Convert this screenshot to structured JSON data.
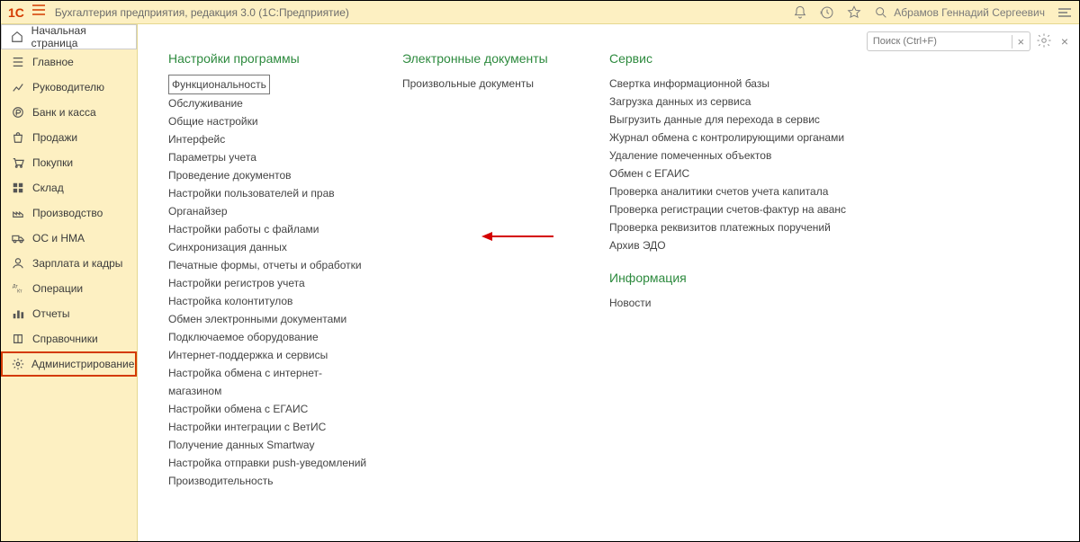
{
  "topbar": {
    "logo": "1C",
    "title": "Бухгалтерия предприятия, редакция 3.0  (1С:Предприятие)",
    "user": "Абрамов Геннадий Сергеевич"
  },
  "sidebar": {
    "home": "Начальная страница",
    "items": [
      {
        "icon": "list",
        "label": "Главное"
      },
      {
        "icon": "chart",
        "label": "Руководителю"
      },
      {
        "icon": "ruble",
        "label": "Банк и касса"
      },
      {
        "icon": "bag",
        "label": "Продажи"
      },
      {
        "icon": "cart",
        "label": "Покупки"
      },
      {
        "icon": "boxes",
        "label": "Склад"
      },
      {
        "icon": "factory",
        "label": "Производство"
      },
      {
        "icon": "truck",
        "label": "ОС и НМА"
      },
      {
        "icon": "person",
        "label": "Зарплата и кадры"
      },
      {
        "icon": "dkt",
        "label": "Операции"
      },
      {
        "icon": "bars",
        "label": "Отчеты"
      },
      {
        "icon": "book",
        "label": "Справочники"
      },
      {
        "icon": "gear",
        "label": "Администрирование"
      }
    ]
  },
  "columns": {
    "settings": {
      "title": "Настройки программы",
      "items": [
        "Функциональность",
        "Обслуживание",
        "Общие настройки",
        "Интерфейс",
        "Параметры учета",
        "Проведение документов",
        "Настройки пользователей и прав",
        "Органайзер",
        "Настройки работы с файлами",
        "Синхронизация данных",
        "Печатные формы, отчеты и обработки",
        "Настройки регистров учета",
        "Настройка колонтитулов",
        "Обмен электронными документами",
        "Подключаемое оборудование",
        "Интернет-поддержка и сервисы",
        "Настройка обмена с интернет-магазином",
        "Настройки обмена с ЕГАИС",
        "Настройки интеграции с ВетИС",
        "Получение данных Smartway",
        "Настройка отправки push-уведомлений",
        "Производительность"
      ]
    },
    "edocs": {
      "title": "Электронные документы",
      "items": [
        "Произвольные документы"
      ]
    },
    "service": {
      "title": "Сервис",
      "items": [
        "Свертка информационной базы",
        "Загрузка данных из сервиса",
        "Выгрузить данные для перехода в сервис",
        "Журнал обмена с контролирующими органами",
        "Удаление помеченных объектов",
        "Обмен с ЕГАИС",
        "Проверка аналитики счетов учета капитала",
        "Проверка регистрации счетов-фактур на аванс",
        "Проверка реквизитов платежных поручений",
        "Архив ЭДО"
      ]
    },
    "info": {
      "title": "Информация",
      "items": [
        "Новости"
      ]
    }
  },
  "toolbar": {
    "search_placeholder": "Поиск (Ctrl+F)",
    "clear": "×",
    "close": "×"
  }
}
